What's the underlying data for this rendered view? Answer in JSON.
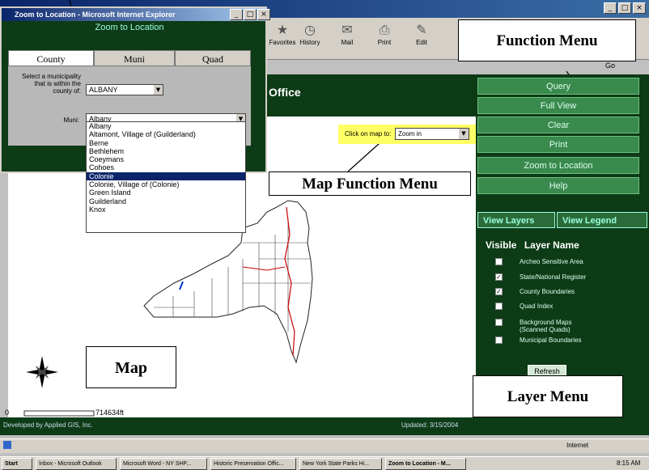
{
  "window": {
    "buttons": [
      "_",
      "□",
      "×"
    ]
  },
  "toolbar": [
    {
      "label": "Favorites",
      "icon": "favorites-icon"
    },
    {
      "label": "History",
      "icon": "history-icon"
    },
    {
      "label": "Mail",
      "icon": "mail-icon"
    },
    {
      "label": "Print",
      "icon": "print-icon"
    },
    {
      "label": "Edit",
      "icon": "edit-icon"
    }
  ],
  "address_go": "Go",
  "page_header": "Office",
  "map_tools": {
    "label": "Click on map to:",
    "selected": "Zoom in"
  },
  "function_menu": [
    "Query",
    "Full View",
    "Clear",
    "Print",
    "Zoom to Location",
    "Help"
  ],
  "layer_tabs": [
    "View Layers",
    "View Legend"
  ],
  "layer_header": {
    "visible": "Visible",
    "name": "Layer Name"
  },
  "layers": [
    {
      "name": "Archeo Sensitive Area",
      "checked": false
    },
    {
      "name": "State/National Register",
      "checked": true
    },
    {
      "name": "County Boundaries",
      "checked": true
    },
    {
      "name": "Quad Index",
      "checked": false
    },
    {
      "name": "Background Maps (Scanned Quads)",
      "checked": false
    },
    {
      "name": "Municipal Boundaries",
      "checked": false
    }
  ],
  "refresh_label": "Refresh",
  "scale_bar": {
    "start": "0",
    "end": "714634ft"
  },
  "footer": {
    "left": "Developed by Applied GIS, Inc.",
    "right": "Updated: 3/15/2004"
  },
  "status": {
    "zone": "Internet"
  },
  "taskbar": {
    "start": "Start",
    "tasks": [
      "Inbox - Microsoft Outlook",
      "Microsoft Word - NY SHP...",
      "Historic Preservation Offic...",
      "New York State Parks  Hi...",
      "Zoom to Location - M..."
    ],
    "time": "8:15 AM"
  },
  "popup": {
    "title": "Zoom to Location - Microsoft Internet Explorer",
    "header": "Zoom to Location",
    "tabs": [
      "County",
      "Muni",
      "Quad"
    ],
    "county_label": "Select a municipality that is within the county of:",
    "county_value": "ALBANY",
    "muni_label": "Muni:",
    "muni_value": "Albany",
    "muni_options": [
      "Albany",
      "Altamont, Village of (Guilderland)",
      "Berne",
      "Bethlehem",
      "Coeymans",
      "Cohoes",
      "Colonie",
      "Colonie, Village of (Colonie)",
      "Green Island",
      "Guilderland",
      "Knox"
    ],
    "selected_index": 6
  },
  "callouts": {
    "function_menu": "Function Menu",
    "map_function_menu": "Map Function Menu",
    "map": "Map",
    "layer_menu": "Layer Menu"
  },
  "colors": {
    "dark_green": "#0d3b16",
    "button_green": "#3a8a4e",
    "highlight_yellow": "#ffff66",
    "selection_blue": "#0a246a"
  }
}
